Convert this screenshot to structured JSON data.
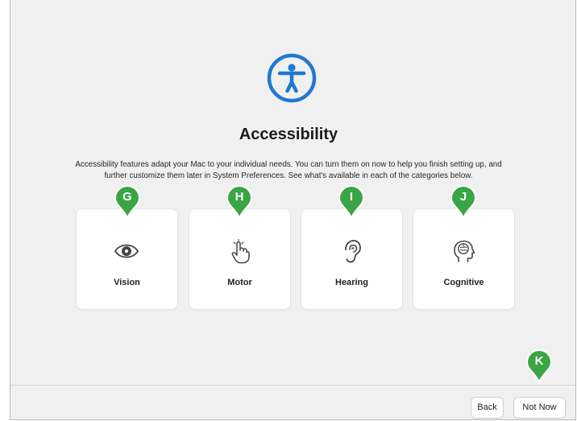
{
  "page": {
    "title": "Accessibility",
    "description": "Accessibility features adapt your Mac to your individual needs. You can turn them on now to help you finish setting up, and further customize them later in System Preferences. See what's available in each of the categories below.",
    "icon": "accessibility-icon"
  },
  "categories": [
    {
      "label": "Vision",
      "icon": "eye-icon"
    },
    {
      "label": "Motor",
      "icon": "pointing-hand-icon"
    },
    {
      "label": "Hearing",
      "icon": "ear-icon"
    },
    {
      "label": "Cognitive",
      "icon": "head-brain-icon"
    }
  ],
  "callouts": [
    "G",
    "H",
    "I",
    "J",
    "K"
  ],
  "buttons": {
    "back": "Back",
    "not_now": "Not Now"
  },
  "colors": {
    "accent": "#1f78d1",
    "callout": "#3aa545",
    "background": "#f0f0f0"
  }
}
